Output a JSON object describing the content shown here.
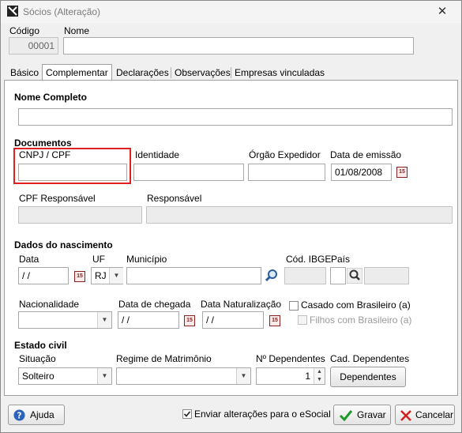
{
  "window": {
    "title": "Sócios (Alteração)",
    "close_glyph": "✕"
  },
  "header": {
    "codigo_label": "Código",
    "codigo_value": "00001",
    "nome_label": "Nome",
    "nome_value": ""
  },
  "tabs": [
    {
      "label": "Básico",
      "active": false
    },
    {
      "label": "Complementar",
      "active": true
    },
    {
      "label": "Declarações",
      "active": false
    },
    {
      "label": "Observações",
      "active": false
    },
    {
      "label": "Empresas vinculadas",
      "active": false
    }
  ],
  "complementar": {
    "nome_completo_label": "Nome Completo",
    "nome_completo_value": "",
    "documentos": {
      "title": "Documentos",
      "cnpj_cpf_label": "CNPJ / CPF",
      "cnpj_cpf_value": "",
      "identidade_label": "Identidade",
      "identidade_value": "",
      "orgao_label": "Órgão Expedidor",
      "orgao_value": "",
      "data_emissao_label": "Data de emissão",
      "data_emissao_value": "01/08/2008",
      "cpf_resp_label": "CPF Responsável",
      "cpf_resp_value": "",
      "responsavel_label": "Responsável",
      "responsavel_value": ""
    },
    "nascimento": {
      "title": "Dados do nascimento",
      "data_label": "Data",
      "data_value": " /  /",
      "uf_label": "UF",
      "uf_value": "RJ",
      "municipio_label": "Município",
      "municipio_value": "",
      "cod_ibge_label": "Cód. IBGE",
      "cod_ibge_value": "",
      "pais_label": "País",
      "pais_value": "",
      "pais_name_value": "",
      "nacionalidade_label": "Nacionalidade",
      "nacionalidade_value": "",
      "data_chegada_label": "Data de chegada",
      "data_chegada_value": " /  /",
      "data_nat_label": "Data Naturalização",
      "data_nat_value": " /  /",
      "casado_label": "Casado com Brasileiro (a)",
      "filhos_label": "Filhos com Brasileiro (a)"
    },
    "estado_civil": {
      "title": "Estado civil",
      "situacao_label": "Situação",
      "situacao_value": "Solteiro",
      "regime_label": "Regime de Matrimônio",
      "regime_value": "",
      "dependentes_label": "Nº Dependentes",
      "dependentes_value": "1",
      "cad_dep_label": "Cad. Dependentes",
      "dependentes_button": "Dependentes"
    }
  },
  "footer": {
    "ajuda_button": "Ajuda",
    "enviar_label": "Enviar alterações para o eSocial",
    "enviar_checked": true,
    "gravar_button": "Gravar",
    "cancelar_button": "Cancelar"
  },
  "colors": {
    "highlight": "#e02020",
    "panel": "#ffffff",
    "window": "#f0f0f0"
  },
  "icons": [
    "app-icon",
    "close-icon",
    "calendar-icon",
    "search-icon",
    "help-icon",
    "check-icon",
    "cancel-icon"
  ]
}
